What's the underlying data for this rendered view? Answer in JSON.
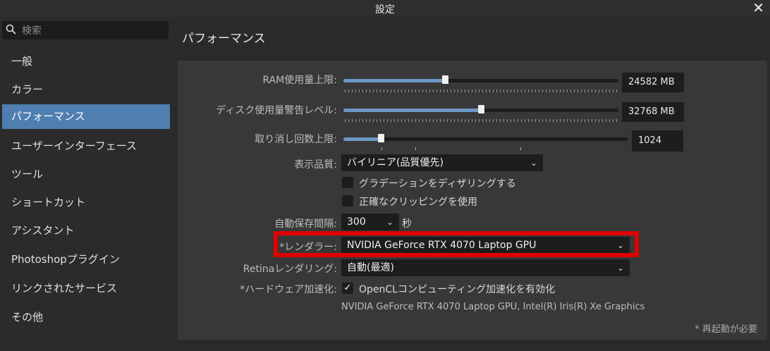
{
  "window": {
    "title": "設定",
    "close": "✕"
  },
  "search": {
    "icon": "search-icon",
    "placeholder": "検索"
  },
  "sidebar": {
    "items": [
      {
        "label": "一般"
      },
      {
        "label": "カラー"
      },
      {
        "label": "パフォーマンス",
        "active": true
      },
      {
        "label": "ユーザーインターフェース"
      },
      {
        "label": "ツール"
      },
      {
        "label": "ショートカット"
      },
      {
        "label": "アシスタント"
      },
      {
        "label": "Photoshopプラグイン"
      },
      {
        "label": "リンクされたサービス"
      },
      {
        "label": "その他"
      }
    ]
  },
  "section": {
    "title": "パフォーマンス"
  },
  "settings": {
    "ram": {
      "label": "RAM使用量上限:",
      "value": "24582 MB",
      "fraction": 0.37
    },
    "disk": {
      "label": "ディスク使用量警告レベル:",
      "value": "32768 MB",
      "fraction": 0.5
    },
    "undo": {
      "label": "取り消し回数上限:",
      "value": "1024",
      "fraction": 0.13
    },
    "display_quality": {
      "label": "表示品質:",
      "value": "バイリニア(品質優先)"
    },
    "dither": {
      "label": "グラデーションをディザリングする",
      "checked": false
    },
    "clipping": {
      "label": "正確なクリッピングを使用",
      "checked": false
    },
    "autosave": {
      "label": "自動保存間隔:",
      "value": "300",
      "unit": "秒"
    },
    "renderer": {
      "label": "*レンダラー:",
      "value": "NVIDIA GeForce RTX 4070 Laptop GPU"
    },
    "retina": {
      "label": "Retinaレンダリング:",
      "value": "自動(最適)"
    },
    "hw_accel": {
      "label": "*ハードウェア加速化:",
      "checkbox_label": "OpenCLコンピューティング加速化を有効化",
      "checked": true
    },
    "gpu_info": "NVIDIA GeForce RTX 4070 Laptop GPU, Intel(R) Iris(R) Xe Graphics",
    "restart_note": "* 再起動が必要"
  },
  "colors": {
    "accent": "#4f7fb1",
    "slider_fill": "#6d97c5",
    "highlight": "#e00000"
  }
}
